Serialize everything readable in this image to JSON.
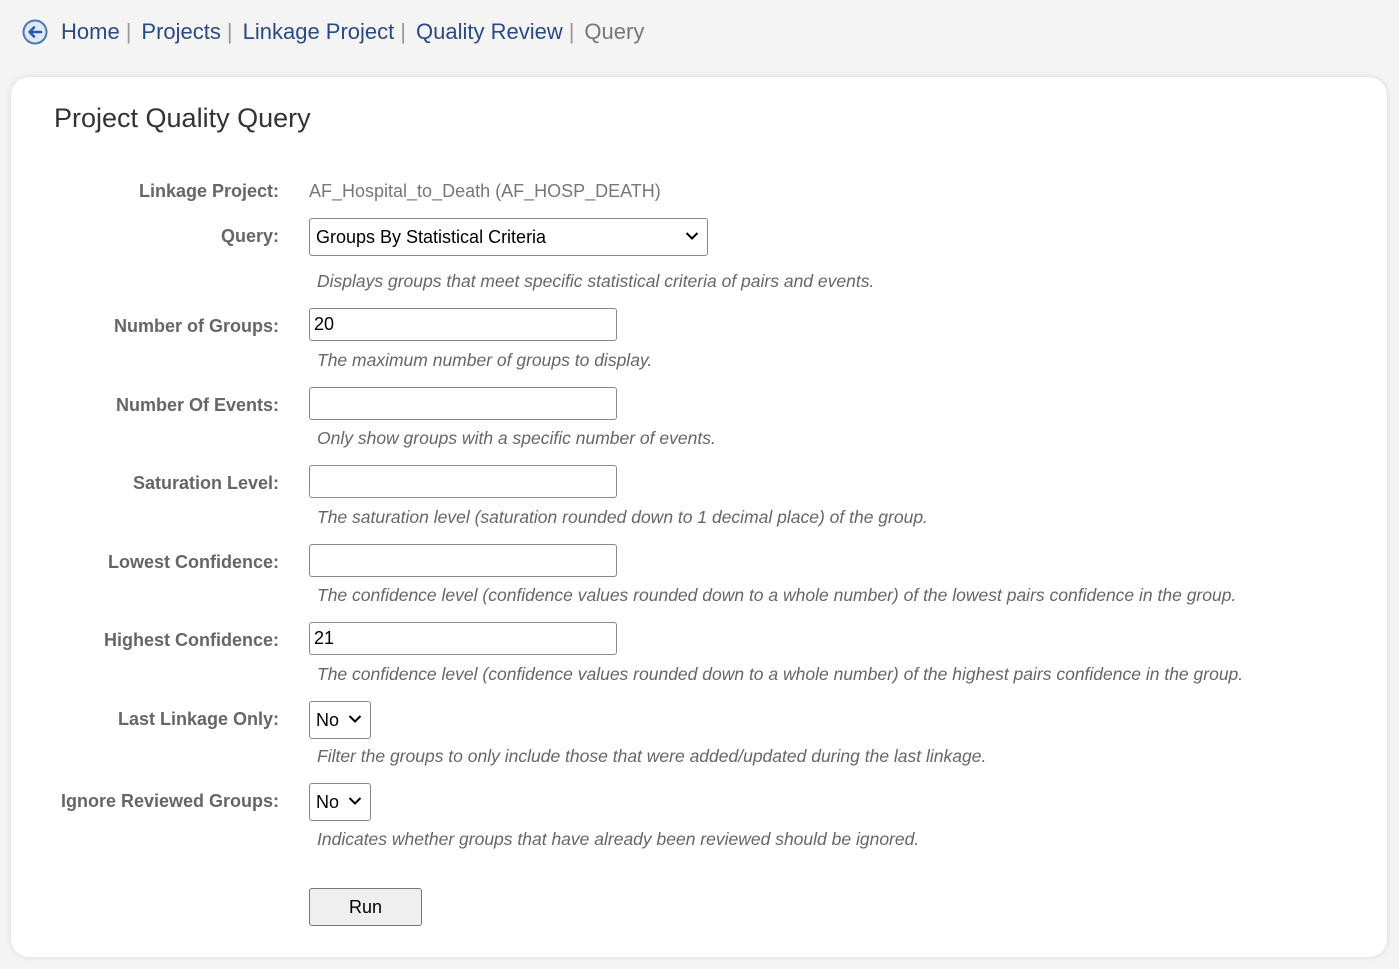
{
  "breadcrumb": {
    "items": [
      "Home",
      "Projects",
      "Linkage Project",
      "Quality Review"
    ],
    "separator": "|",
    "current": "Query"
  },
  "page": {
    "title": "Project Quality Query"
  },
  "form": {
    "linkage_project": {
      "label": "Linkage Project:",
      "value": "AF_Hospital_to_Death (AF_HOSP_DEATH)"
    },
    "query": {
      "label": "Query:",
      "selected": "Groups By Statistical Criteria",
      "hint": "Displays groups that meet specific statistical criteria of pairs and events."
    },
    "number_of_groups": {
      "label": "Number of Groups:",
      "value": "20",
      "hint": "The maximum number of groups to display."
    },
    "number_of_events": {
      "label": "Number Of Events:",
      "value": "",
      "hint": "Only show groups with a specific number of events."
    },
    "saturation_level": {
      "label": "Saturation Level:",
      "value": "",
      "hint": "The saturation level (saturation rounded down to 1 decimal place) of the group."
    },
    "lowest_confidence": {
      "label": "Lowest Confidence:",
      "value": "",
      "hint": "The confidence level (confidence values rounded down to a whole number) of the lowest pairs confidence in the group."
    },
    "highest_confidence": {
      "label": "Highest Confidence:",
      "value": "21",
      "hint": "The confidence level (confidence values rounded down to a whole number) of the highest pairs confidence in the group."
    },
    "last_linkage_only": {
      "label": "Last Linkage Only:",
      "selected": "No",
      "hint": "Filter the groups to only include those that were added/updated during the last linkage."
    },
    "ignore_reviewed": {
      "label": "Ignore Reviewed Groups:",
      "selected": "No",
      "hint": "Indicates whether groups that have already been reviewed should be ignored."
    },
    "run_label": "Run"
  },
  "icons": {
    "back": "back-arrow-circle-icon",
    "dropdown": "chevron-down-icon"
  },
  "colors": {
    "link": "#2a4a86",
    "label": "#666666",
    "background": "#f4f4f4"
  }
}
